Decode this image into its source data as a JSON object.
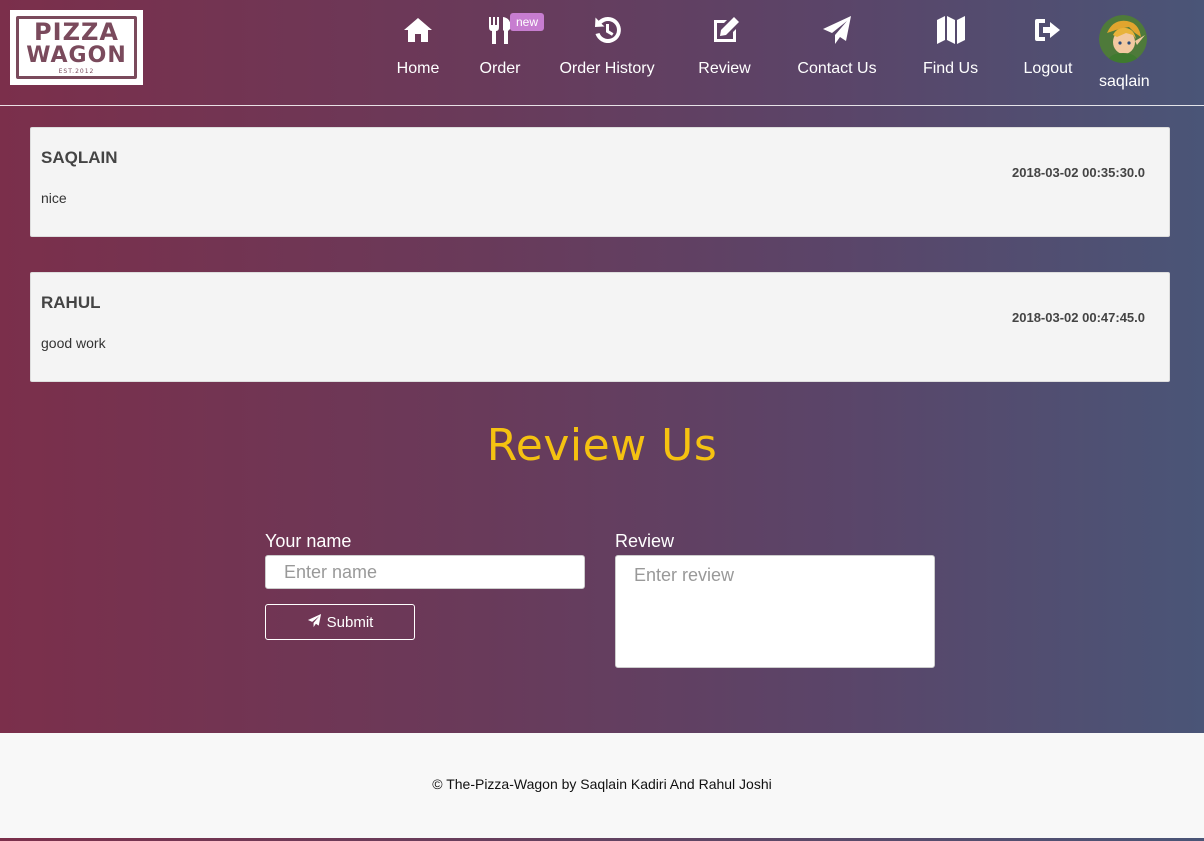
{
  "brand": {
    "logo_line1": "PIZZA",
    "logo_line2": "WAGON",
    "logo_est": "EST.2012"
  },
  "nav": {
    "items": [
      {
        "label": "Home",
        "icon": "home-icon"
      },
      {
        "label": "Order",
        "icon": "cutlery-icon",
        "badge": "new"
      },
      {
        "label": "Order History",
        "icon": "history-icon"
      },
      {
        "label": "Review",
        "icon": "edit-icon"
      },
      {
        "label": "Contact Us",
        "icon": "paper-plane-icon"
      },
      {
        "label": "Find Us",
        "icon": "map-icon"
      },
      {
        "label": "Logout",
        "icon": "logout-icon"
      }
    ],
    "user": {
      "name": "saqlain",
      "avatar": "avatar-image"
    }
  },
  "reviews": [
    {
      "name": "SAQLAIN",
      "date": "2018-03-02 00:35:30.0",
      "text": "nice"
    },
    {
      "name": "RAHUL",
      "date": "2018-03-02 00:47:45.0",
      "text": "good work"
    }
  ],
  "form": {
    "title": "Review Us",
    "name_label": "Your name",
    "name_placeholder": "Enter name",
    "review_label": "Review",
    "review_placeholder": "Enter review",
    "submit_label": "Submit"
  },
  "footer": {
    "text": "© The-Pizza-Wagon by Saqlain Kadiri And Rahul Joshi"
  },
  "colors": {
    "gradient_start": "#7b2f4b",
    "gradient_end": "#4a5577",
    "title_color": "#f5c211",
    "badge_color": "#c77dd0"
  }
}
